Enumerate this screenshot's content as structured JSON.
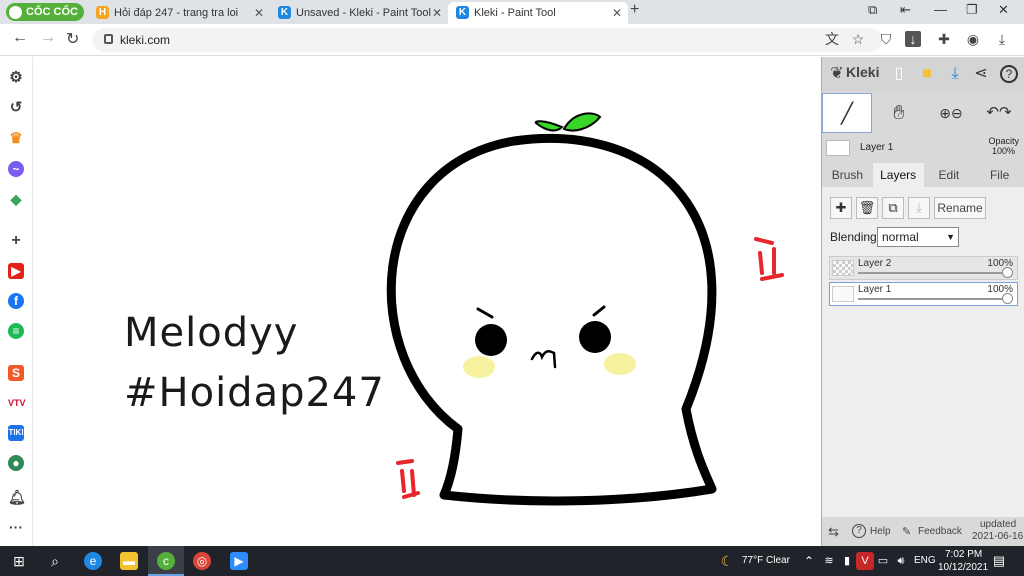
{
  "browser": {
    "brand": "CỐC CỐC",
    "tabs": [
      {
        "title": "Hỏi đáp 247 - trang tra loi",
        "active": false
      },
      {
        "title": "Unsaved - Kleki - Paint Tool",
        "active": false
      },
      {
        "title": "Kleki - Paint Tool",
        "active": true
      }
    ],
    "url": "kleki.com"
  },
  "canvas": {
    "line1": "Melodyy",
    "line2": "#Hoidap247"
  },
  "kleki": {
    "logo": "Kleki",
    "layer_current": "Layer 1",
    "opacity_label": "Opacity",
    "opacity_value": "100%",
    "tabs": [
      "Brush",
      "Layers",
      "Edit",
      "File"
    ],
    "active_tab": "Layers",
    "rename_label": "Rename",
    "blending_label": "Blending",
    "blending_value": "normal",
    "layers": [
      {
        "name": "Layer 2",
        "opacity": "100%",
        "selected": false
      },
      {
        "name": "Layer 1",
        "opacity": "100%",
        "selected": true
      }
    ],
    "help": "Help",
    "feedback": "Feedback",
    "updated_label": "updated",
    "updated_date": "2021-06-16"
  },
  "taskbar": {
    "weather": "77°F  Clear",
    "lang": "ENG",
    "time": "7:02 PM",
    "date": "10/12/2021"
  },
  "colors": {
    "accent": "#55b03b",
    "kleki_blue": "#1e88e5",
    "sprout": "#39d62a",
    "blush": "#f6f2a0",
    "anger": "#e8262b"
  }
}
